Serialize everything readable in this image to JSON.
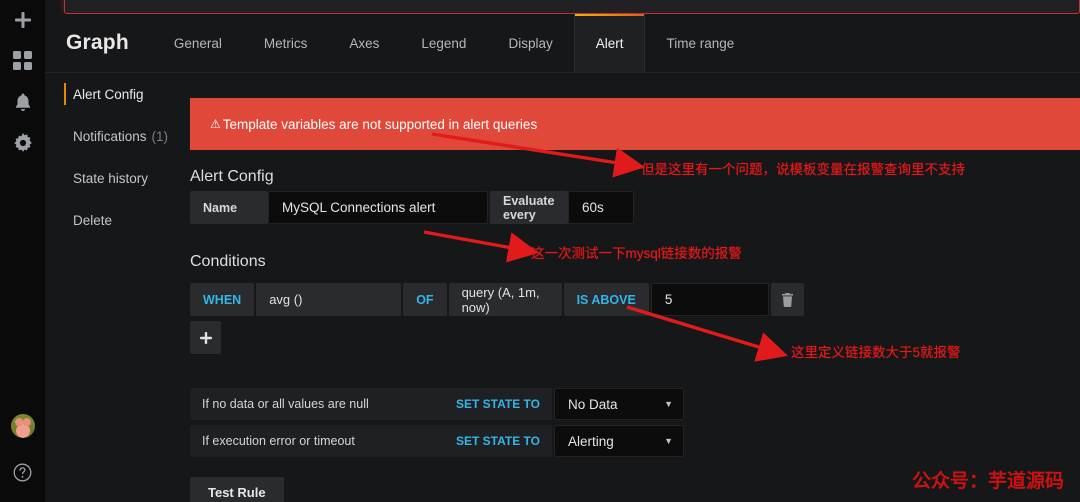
{
  "rail": {
    "items": [
      {
        "name": "add-icon",
        "glyph": "plus"
      },
      {
        "name": "dashboards-icon",
        "glyph": "squares"
      },
      {
        "name": "alerting-bell-icon",
        "glyph": "bell"
      },
      {
        "name": "configuration-gear-icon",
        "glyph": "gear"
      },
      {
        "name": "user-avatar",
        "glyph": "avatar"
      },
      {
        "name": "help-icon",
        "glyph": "question"
      }
    ]
  },
  "header": {
    "panel_title": "Graph",
    "tabs": [
      {
        "label": "General",
        "active": false
      },
      {
        "label": "Metrics",
        "active": false
      },
      {
        "label": "Axes",
        "active": false
      },
      {
        "label": "Legend",
        "active": false
      },
      {
        "label": "Display",
        "active": false
      },
      {
        "label": "Alert",
        "active": true
      },
      {
        "label": "Time range",
        "active": false
      }
    ],
    "active_tab_accent": "#e8870b"
  },
  "sidebar": {
    "items": [
      {
        "label": "Alert Config",
        "count": "",
        "active": true
      },
      {
        "label": "Notifications",
        "count": "(1)",
        "active": false
      },
      {
        "label": "State history",
        "count": "",
        "active": false
      },
      {
        "label": "Delete",
        "count": "",
        "active": false
      }
    ]
  },
  "warning": {
    "icon": "warning-triangle-icon",
    "message": "Template variables are not supported in alert queries",
    "background": "#e0483a"
  },
  "alert_config": {
    "section_title": "Alert Config",
    "name_label": "Name",
    "name_value": "MySQL Connections alert",
    "name_placeholder": "Name",
    "evaluate_label": "Evaluate every",
    "evaluate_value": "60s",
    "evaluate_placeholder": "60s"
  },
  "conditions": {
    "section_title": "Conditions",
    "when_label": "WHEN",
    "reducer_value": "avg ()",
    "of_label": "OF",
    "query_value": "query (A, 1m, now)",
    "evaluator_label": "IS ABOVE",
    "threshold_value": "5",
    "threshold_placeholder": "5",
    "delete_icon": "trash-icon",
    "add_icon": "plus-icon"
  },
  "state_rules": [
    {
      "description": "If no data or all values are null",
      "set_state_to": "SET STATE TO",
      "state_value": "No Data"
    },
    {
      "description": "If execution error or timeout",
      "set_state_to": "SET STATE TO",
      "state_value": "Alerting"
    }
  ],
  "footer": {
    "test_rule_label": "Test Rule"
  },
  "annotations": {
    "note_1": "但是这里有一个问题，说模板变量在报警查询里不支持",
    "note_2": "这一次测试一下mysql链接数的报警",
    "note_3": "这里定义链接数大于5就报警",
    "watermark": "公众号：芋道源码",
    "color": "#e11b1b"
  }
}
